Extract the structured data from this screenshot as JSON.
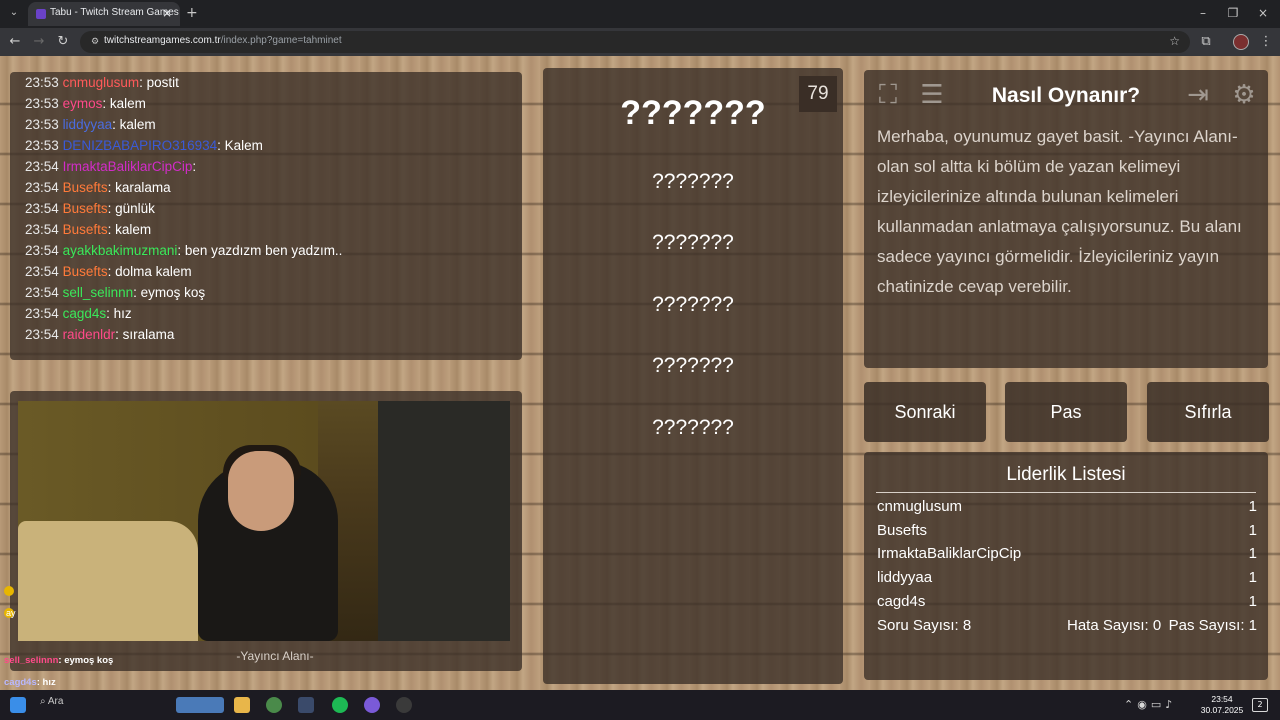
{
  "browser": {
    "tab_title": "Tabu - Twitch Stream Games",
    "url_host": "twitchstreamgames.com.tr",
    "url_path": "/index.php?game=tahminet"
  },
  "chat": {
    "messages": [
      {
        "time": "23:53",
        "user": "cnmuglusum",
        "color": "#ff5a5a",
        "text": ": postit"
      },
      {
        "time": "23:53",
        "user": "eymos",
        "color": "#ff4a8a",
        "text": ": kalem"
      },
      {
        "time": "23:53",
        "user": "liddyyaa",
        "color": "#4a6ce0",
        "text": ": kalem"
      },
      {
        "time": "23:53",
        "user": "DENIZBABAPIRO316934",
        "color": "#3a5ad8",
        "text": ": Kalem"
      },
      {
        "time": "23:54",
        "user": "IrmaktaBaliklarCipCip",
        "color": "#d22cc8",
        "text": ": "
      },
      {
        "time": "23:54",
        "user": "Busefts",
        "color": "#ff7a3a",
        "text": ": karalama"
      },
      {
        "time": "23:54",
        "user": "Busefts",
        "color": "#ff7a3a",
        "text": ": günlük"
      },
      {
        "time": "23:54",
        "user": "Busefts",
        "color": "#ff7a3a",
        "text": ": kalem"
      },
      {
        "time": "23:54",
        "user": "ayakkbakimuzmani",
        "color": "#3ae85a",
        "text": ": ben yazdızm ben yadzım.."
      },
      {
        "time": "23:54",
        "user": "Busefts",
        "color": "#ff7a3a",
        "text": ": dolma kalem"
      },
      {
        "time": "23:54",
        "user": "sell_selinnn",
        "color": "#3ae85a",
        "text": ": eymoş koş"
      },
      {
        "time": "23:54",
        "user": "cagd4s",
        "color": "#3ae85a",
        "text": ": hız"
      },
      {
        "time": "23:54",
        "user": "raidenldr",
        "color": "#ff4a8a",
        "text": ": sıralama"
      }
    ]
  },
  "cam": {
    "label": "-Yayıncı Alanı-"
  },
  "overlay": {
    "side_text": "ay",
    "rows": [
      {
        "user": "sell_selinnn",
        "color": "#ff4a8a",
        "text": ": eymoş koş"
      },
      {
        "user": "cagd4s",
        "color": "#b8b8ff",
        "text": ": hız"
      },
      {
        "user": "raidenldr",
        "color": "#ff4a8a",
        "text": ": sıralama"
      }
    ]
  },
  "words": {
    "timer": "79",
    "main": "???????",
    "taboo": [
      "???????",
      "???????",
      "???????",
      "???????",
      "???????"
    ]
  },
  "howto": {
    "title": "Nasıl Oynanır?",
    "text": "Merhaba, oyunumuz gayet basit. -Yayıncı Alanı- olan sol altta ki bölüm de yazan kelimeyi izleyicilerinize altında bulunan kelimeleri kullanmadan anlatmaya çalışıyorsunuz. Bu alanı sadece yayıncı görmelidir. İzleyicileriniz yayın chatinizde cevap verebilir.",
    "icons": [
      "expand-icon",
      "list-icon",
      "exit-icon",
      "gear-icon"
    ]
  },
  "actions": {
    "next": "Sonraki",
    "pass": "Pas",
    "reset": "Sıfırla"
  },
  "leaderboard": {
    "title": "Liderlik Listesi",
    "rows": [
      {
        "name": "cnmuglusum",
        "score": "1"
      },
      {
        "name": "Busefts",
        "score": "1"
      },
      {
        "name": "IrmaktaBaliklarCipCip",
        "score": "1"
      },
      {
        "name": "liddyyaa",
        "score": "1"
      },
      {
        "name": "cagd4s",
        "score": "1"
      }
    ],
    "questions": "Soru Sayısı: 8",
    "errors": "Hata Sayısı: 0",
    "passes": "Pas Sayısı: 1"
  },
  "taskbar": {
    "search": "Ara",
    "time": "23:54",
    "date": "30.07.2025",
    "notifications": "2"
  }
}
